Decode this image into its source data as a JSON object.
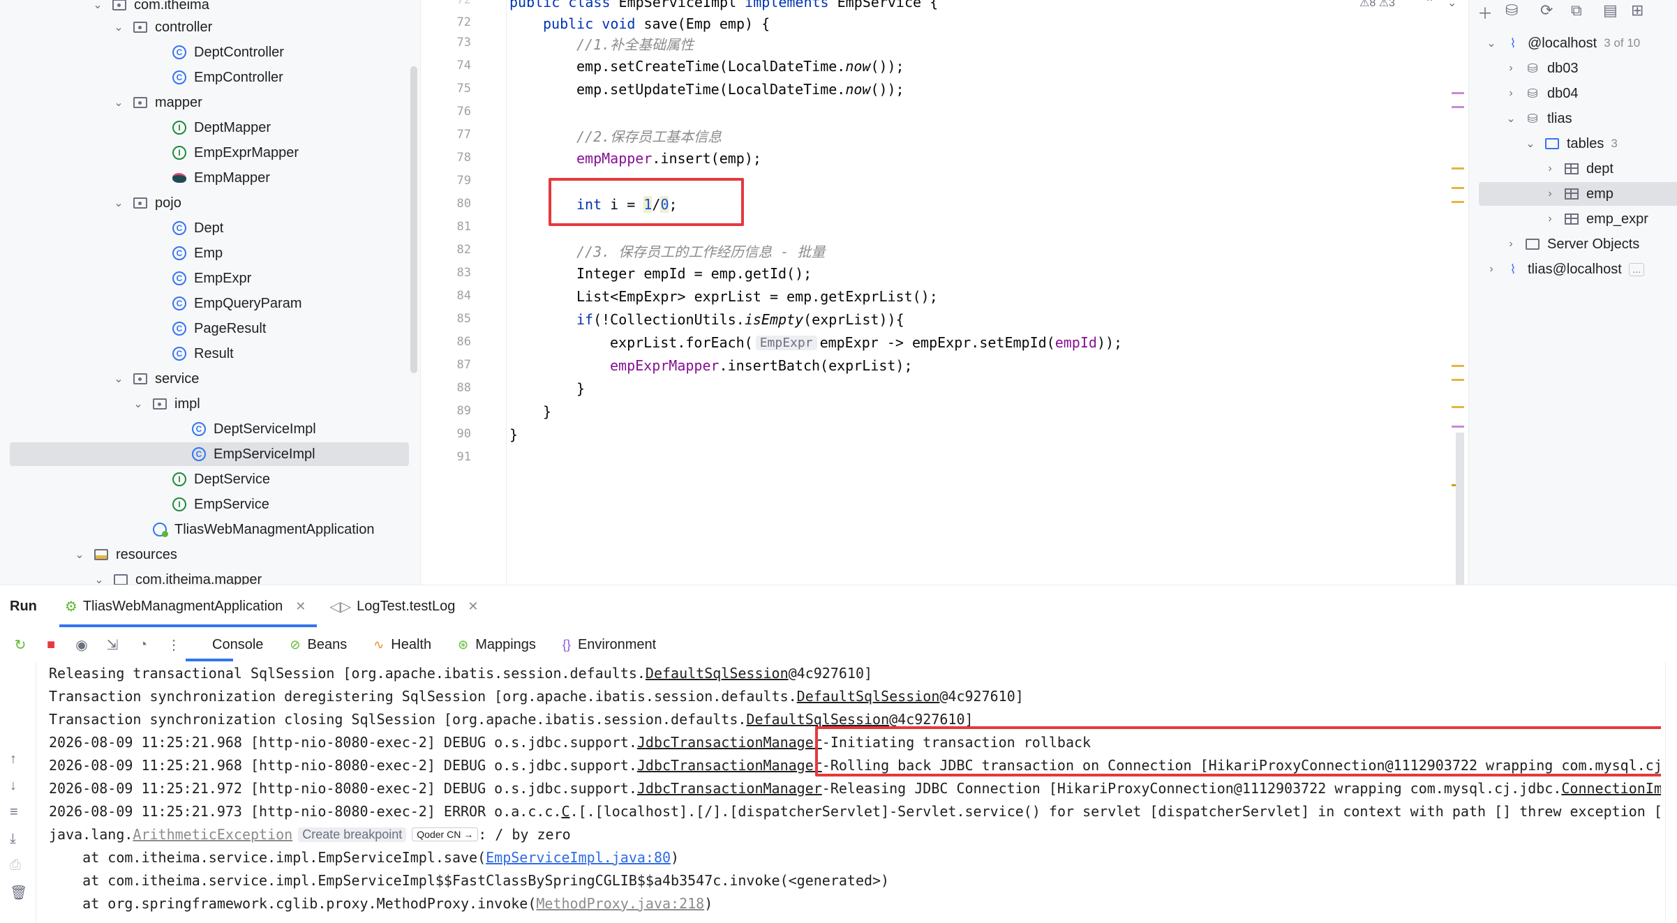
{
  "project_tree": {
    "items": [
      {
        "label": "com.itheima",
        "icon": "package-folder-icon",
        "chevron": "⌄"
      },
      {
        "label": "controller",
        "icon": "package-folder-icon",
        "chevron": "⌄"
      },
      {
        "label": "DeptController",
        "icon": "class-icon",
        "chevron": ""
      },
      {
        "label": "EmpController",
        "icon": "class-icon",
        "chevron": ""
      },
      {
        "label": "mapper",
        "icon": "package-folder-icon",
        "chevron": "⌄"
      },
      {
        "label": "DeptMapper",
        "icon": "interface-icon",
        "chevron": ""
      },
      {
        "label": "EmpExprMapper",
        "icon": "interface-icon",
        "chevron": ""
      },
      {
        "label": "EmpMapper",
        "icon": "mybatis-mapper-icon",
        "chevron": ""
      },
      {
        "label": "pojo",
        "icon": "package-folder-icon",
        "chevron": "⌄"
      },
      {
        "label": "Dept",
        "icon": "class-icon",
        "chevron": ""
      },
      {
        "label": "Emp",
        "icon": "class-icon",
        "chevron": ""
      },
      {
        "label": "EmpExpr",
        "icon": "class-icon",
        "chevron": ""
      },
      {
        "label": "EmpQueryParam",
        "icon": "class-icon",
        "chevron": ""
      },
      {
        "label": "PageResult",
        "icon": "class-icon",
        "chevron": ""
      },
      {
        "label": "Result",
        "icon": "class-icon",
        "chevron": ""
      },
      {
        "label": "service",
        "icon": "package-folder-icon",
        "chevron": "⌄"
      },
      {
        "label": "impl",
        "icon": "package-folder-icon",
        "chevron": "⌄"
      },
      {
        "label": "DeptServiceImpl",
        "icon": "class-icon",
        "chevron": ""
      },
      {
        "label": "EmpServiceImpl",
        "icon": "class-icon",
        "chevron": "",
        "selected": true
      },
      {
        "label": "DeptService",
        "icon": "interface-icon",
        "chevron": ""
      },
      {
        "label": "EmpService",
        "icon": "interface-icon",
        "chevron": ""
      },
      {
        "label": "TliasWebManagmentApplication",
        "icon": "spring-boot-class-icon",
        "chevron": ""
      },
      {
        "label": "resources",
        "icon": "resources-folder-icon",
        "chevron": "⌄"
      },
      {
        "label": "com.itheima.mapper",
        "icon": "folder-icon",
        "chevron": "⌄"
      }
    ]
  },
  "editor": {
    "inspections": {
      "warnings": "8",
      "weak_warnings": "3"
    },
    "line_numbers": [
      "72",
      "73",
      "74",
      "75",
      "76",
      "77",
      "78",
      "79",
      "80",
      "81",
      "82",
      "83",
      "84",
      "85",
      "86",
      "87",
      "88",
      "89",
      "90",
      "91"
    ],
    "line_72_number_partial": "72",
    "top_line": {
      "number": "72",
      "text": "public class EmpServiceImpl implements EmpService {"
    },
    "lines": {
      "l72a": "public",
      "l72b": " void ",
      "l72c": "save(Emp emp) {",
      "l73": "//1.补全基础属性",
      "l74a": "emp.setCreateTime(LocalDateTime.",
      "l74b": "now",
      "l74c": "());",
      "l75a": "emp.setUpdateTime(LocalDateTime.",
      "l75b": "now",
      "l75c": "());",
      "l77": "//2.保存员工基本信息",
      "l78a": "empMapper",
      "l78b": ".insert(emp);",
      "l80a": "int",
      "l80b": " i = ",
      "l80c": "1",
      "l80d": "/",
      "l80e": "0",
      "l80f": ";",
      "l82": "//3. 保存员工的工作经历信息 - 批量",
      "l83": "Integer empId = emp.getId();",
      "l84": "List<EmpExpr> exprList = emp.getExprList();",
      "l85a": "if",
      "l85b": "(!CollectionUtils.",
      "l85c": "isEmpty",
      "l85d": "(exprList)){",
      "l86a": "exprList.forEach(",
      "l86hint": "EmpExpr",
      "l86b": "empExpr -> empExpr.setEmpId(",
      "l86c": "empId",
      "l86d": "));",
      "l87a": "empExprMapper",
      "l87b": ".insertBatch(exprList);",
      "l88": "}",
      "l89": "}",
      "l90": "}"
    }
  },
  "database": {
    "toolbar": [
      "+",
      "⛁",
      "⟳",
      "⧉",
      "▤",
      "⊞"
    ],
    "items": [
      {
        "label": "@localhost",
        "badge": "3 of 10",
        "icon": "datasource-icon",
        "chevron": "⌄"
      },
      {
        "label": "db03",
        "icon": "database-icon",
        "chevron": "›"
      },
      {
        "label": "db04",
        "icon": "database-icon",
        "chevron": "›"
      },
      {
        "label": "tlias",
        "icon": "database-icon",
        "chevron": "⌄"
      },
      {
        "label": "tables",
        "badge": "3",
        "icon": "folder-icon",
        "chevron": "⌄"
      },
      {
        "label": "dept",
        "icon": "table-icon",
        "chevron": "›"
      },
      {
        "label": "emp",
        "icon": "table-icon",
        "chevron": "›",
        "selected": true
      },
      {
        "label": "emp_expr",
        "icon": "table-icon",
        "chevron": "›"
      },
      {
        "label": "Server Objects",
        "icon": "server-objects-icon",
        "chevron": "›"
      },
      {
        "label": "tlias@localhost",
        "badge": "...",
        "icon": "datasource-icon",
        "chevron": "›"
      }
    ]
  },
  "run_panel": {
    "title": "Run",
    "tabs": [
      {
        "label": "TliasWebManagmentApplication",
        "active": true
      },
      {
        "label": "LogTest.testLog",
        "active": false
      }
    ],
    "subtabs": [
      {
        "label": "Console",
        "icon": ""
      },
      {
        "label": "Beans",
        "icon": "⊘"
      },
      {
        "label": "Health",
        "icon": "∿"
      },
      {
        "label": "Mappings",
        "icon": "⊛"
      },
      {
        "label": "Environment",
        "icon": "{}"
      }
    ],
    "console": {
      "l1a": "Releasing transactional SqlSession [org.apache.ibatis.session.defaults.",
      "l1b": "DefaultSqlSession",
      "l1c": "@4c927610]",
      "l2a": "Transaction synchronization deregistering SqlSession [org.apache.ibatis.session.defaults.",
      "l2b": "DefaultSqlSession",
      "l2c": "@4c927610]",
      "l3a": "Transaction synchronization closing SqlSession [org.apache.ibatis.session.defaults.",
      "l3b": "DefaultSqlSession",
      "l3c": "@4c927610]",
      "l4a": "2026-08-09 11:25:21.968 [http-nio-8080-exec-2] DEBUG o.s.jdbc.support.",
      "l4b": "JdbcTransactionManager",
      "l4c": "-Initiating transaction rollback",
      "l5a": "2026-08-09 11:25:21.968 [http-nio-8080-exec-2] DEBUG o.s.jdbc.support.",
      "l5b": "JdbcTransactionManager",
      "l5c": "-Rolling back JDBC transaction on Connection [HikariProxyConnection@1112903722 wrapping com.mysql.cj.",
      "l6a": "2026-08-09 11:25:21.972 [http-nio-8080-exec-2] DEBUG o.s.jdbc.support.",
      "l6b": "JdbcTransactionManager",
      "l6c": "-Releasing JDBC Connection [HikariProxyConnection@1112903722 wrapping com.mysql.cj.jdbc.",
      "l6d": "ConnectionImp",
      "l7a": "2026-08-09 11:25:21.973 [http-nio-8080-exec-2] ERROR o.a.c.c.",
      "l7b": "C",
      "l7c": ".[.[localhost].[/].[dispatcherServlet]-Servlet.service() for servlet [dispatcherServlet] in context with path [] threw exception [F",
      "l8a": "java.lang.",
      "l8b": "ArithmeticException",
      "l8bp": "Create breakpoint",
      "l8q": "Qoder CN →",
      "l8c": ": / by zero",
      "l9a": "    at com.itheima.service.impl.EmpServiceImpl.save(",
      "l9b": "EmpServiceImpl.java:80",
      "l9c": ")",
      "l10": "    at com.itheima.service.impl.EmpServiceImpl$$FastClassBySpringCGLIB$$a4b3547c.invoke(<generated>)",
      "l11a": "    at org.springframework.cglib.proxy.MethodProxy.invoke(",
      "l11b": "MethodProxy.java:218",
      "l11c": ")"
    }
  }
}
